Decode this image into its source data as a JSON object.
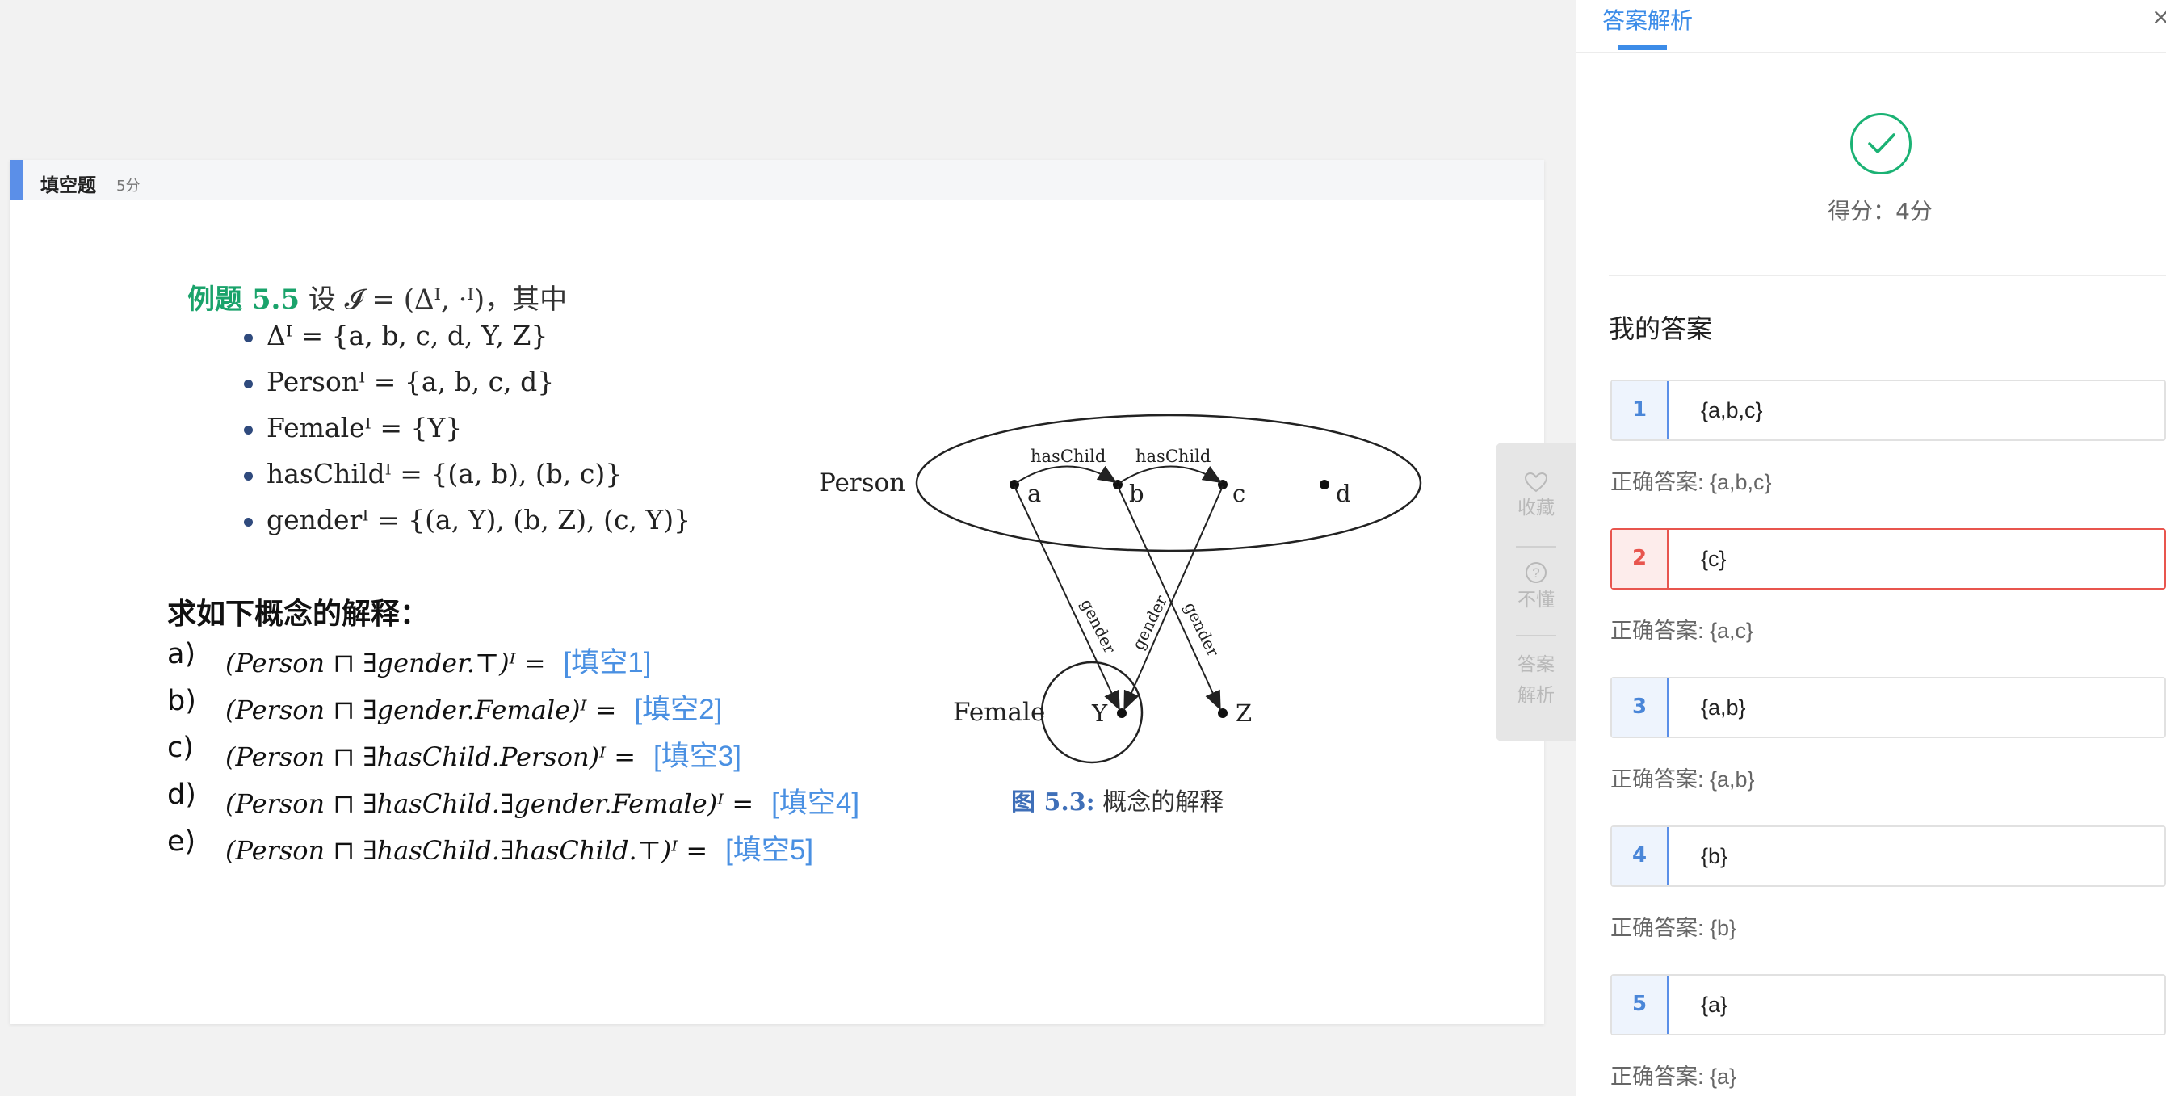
{
  "question": {
    "type_label": "填空题",
    "score_label": "5分",
    "example_tag": "例题 5.5",
    "example_intro": "设 𝓘 = (Δᴵ, ·ᴵ)，其中",
    "definitions": [
      "Δᴵ = {a, b, c, d, Y, Z}",
      "Personᴵ = {a, b, c, d}",
      "Femaleᴵ = {Y}",
      "hasChildᴵ = {(a, b), (b, c)}",
      "genderᴵ = {(a, Y), (b, Z), (c, Y)}"
    ],
    "ask": "求如下概念的解释：",
    "items": [
      {
        "label": "a)",
        "expr": "(Person ⊓ ∃gender.⊤)ᴵ =",
        "blank": "[填空1]"
      },
      {
        "label": "b)",
        "expr": "(Person ⊓ ∃gender.Female)ᴵ =",
        "blank": "[填空2]"
      },
      {
        "label": "c)",
        "expr": "(Person ⊓ ∃hasChild.Person)ᴵ =",
        "blank": "[填空3]"
      },
      {
        "label": "d)",
        "expr": "(Person ⊓ ∃hasChild.∃gender.Female)ᴵ =",
        "blank": "[填空4]"
      },
      {
        "label": "e)",
        "expr": "(Person ⊓ ∃hasChild.∃hasChild.⊤)ᴵ =",
        "blank": "[填空5]"
      }
    ],
    "diagram": {
      "person_label": "Person",
      "female_label": "Female",
      "nodes": [
        "a",
        "b",
        "c",
        "d",
        "Y",
        "Z"
      ],
      "haschild_label": "hasChild",
      "gender_label": "gender"
    },
    "figure_tag": "图 5.3:",
    "figure_caption": "概念的解释"
  },
  "tools": {
    "favorite": "收藏",
    "confused": "不懂",
    "analysis_line1": "答案",
    "analysis_line2": "解析"
  },
  "panel": {
    "tab": "答案解析",
    "close": "×",
    "score": "得分：4分",
    "my_answer_title": "我的答案",
    "answers": [
      {
        "num": "1",
        "value": "{a,b,c}",
        "correct": "正确答案: {a,b,c}",
        "status": "right"
      },
      {
        "num": "2",
        "value": "{c}",
        "correct": "正确答案: {a,c}",
        "status": "wrong"
      },
      {
        "num": "3",
        "value": "{a,b}",
        "correct": "正确答案: {a,b}",
        "status": "right"
      },
      {
        "num": "4",
        "value": "{b}",
        "correct": "正确答案: {b}",
        "status": "right"
      },
      {
        "num": "5",
        "value": "{a}",
        "correct": "正确答案: {a}",
        "status": "right"
      }
    ]
  },
  "colors": {
    "accent": "#3c8ce8",
    "correct_green": "#1bb274",
    "wrong_red": "#e8554e",
    "blank_blue": "#4a90e2",
    "example_green": "#1aa36b"
  }
}
